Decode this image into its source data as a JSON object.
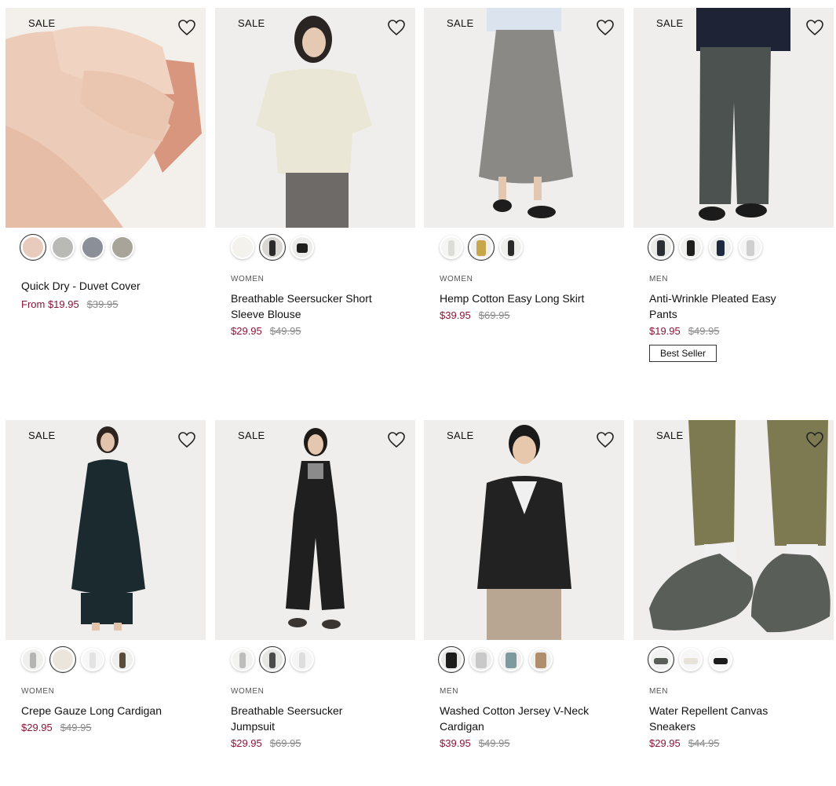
{
  "products": [
    {
      "sale": "SALE",
      "category": "",
      "name": "Quick Dry - Duvet Cover",
      "price": "From $19.95",
      "was": "$39.95",
      "badge": "",
      "swatches": [
        "#e8cbbd",
        "#b9bab6",
        "#8b8f97",
        "#a9a49a"
      ],
      "selected_swatch": 0,
      "image_bg": "#f1ece7"
    },
    {
      "sale": "SALE",
      "category": "WOMEN",
      "name": "Breathable Seersucker Short Sleeve Blouse",
      "price": "$29.95",
      "was": "$49.95",
      "badge": "",
      "swatches": [
        "#f4f2ec",
        "#2b2b2b",
        "#1f1f1f"
      ],
      "selected_swatch": 1,
      "image_bg": "#efeeec"
    },
    {
      "sale": "SALE",
      "category": "WOMEN",
      "name": "Hemp Cotton Easy Long Skirt",
      "price": "$39.95",
      "was": "$69.95",
      "badge": "",
      "swatches": [
        "#ecebe8",
        "#c7a64c",
        "#2a2a2a"
      ],
      "selected_swatch": 1,
      "image_bg": "#efefee"
    },
    {
      "sale": "SALE",
      "category": "MEN",
      "name": "Anti-Wrinkle Pleated Easy Pants",
      "price": "$19.95",
      "was": "$49.95",
      "badge": "Best Seller",
      "swatches": [
        "#2b2f33",
        "#1e1e1e",
        "#1e2a40",
        "#cfcfcf"
      ],
      "selected_swatch": 0,
      "image_bg": "#efefee"
    },
    {
      "sale": "SALE",
      "category": "WOMEN",
      "name": "Crepe Gauze Long Cardigan",
      "price": "$29.95",
      "was": "$49.95",
      "badge": "",
      "swatches": [
        "#b5b5b5",
        "#ebe6dc",
        "#f0f0f0",
        "#5b4b3b"
      ],
      "selected_swatch": 1,
      "image_bg": "#efefee"
    },
    {
      "sale": "SALE",
      "category": "WOMEN",
      "name": "Breathable Seersucker Jumpsuit",
      "price": "$29.95",
      "was": "$69.95",
      "badge": "",
      "swatches": [
        "#bdbdbd",
        "#4a4a4a",
        "#dddddd"
      ],
      "selected_swatch": 1,
      "image_bg": "#efefee"
    },
    {
      "sale": "SALE",
      "category": "MEN",
      "name": "Washed Cotton Jersey V-Neck Cardigan",
      "price": "$39.95",
      "was": "$49.95",
      "badge": "",
      "swatches": [
        "#1c1c1c",
        "#c9c9c9",
        "#7f9a9f",
        "#b08e6d"
      ],
      "selected_swatch": 0,
      "image_bg": "#efefee"
    },
    {
      "sale": "SALE",
      "category": "MEN",
      "name": "Water Repellent Canvas Sneakers",
      "price": "$29.95",
      "was": "$44.95",
      "badge": "",
      "swatches": [
        "#5a5e58",
        "#e7e3da",
        "#1b1b1b"
      ],
      "selected_swatch": 0,
      "image_bg": "#efefee"
    }
  ]
}
